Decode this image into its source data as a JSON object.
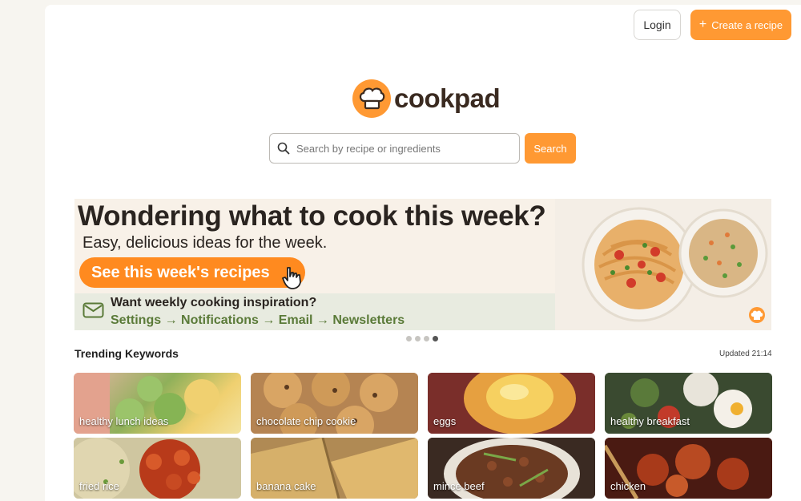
{
  "header": {
    "login_label": "Login",
    "create_label": "Create a recipe"
  },
  "logo": {
    "text": "cookpad"
  },
  "search": {
    "placeholder": "Search by recipe or ingredients",
    "button_label": "Search"
  },
  "banner": {
    "headline": "Wondering what to cook this week?",
    "subheadline": "Easy, delicious ideas for the week.",
    "cta_label": "See this week's recipes",
    "strip_title": "Want weekly cooking inspiration?",
    "strip_path": "Settings → Notifications → Email → Newsletters",
    "logo_text": "cookpad",
    "slide_count": 4,
    "active_slide": 4
  },
  "trending": {
    "title": "Trending Keywords",
    "updated": "Updated 21:14",
    "keywords": [
      {
        "label": "healthy lunch ideas"
      },
      {
        "label": "chocolate chip cookie"
      },
      {
        "label": "eggs"
      },
      {
        "label": "healthy breakfast"
      },
      {
        "label": "fried rice"
      },
      {
        "label": "banana cake"
      },
      {
        "label": "mince beef"
      },
      {
        "label": "chicken"
      }
    ]
  },
  "colors": {
    "accent": "#ff9933",
    "banner_cta": "#ff8a1f",
    "strip_text": "#5a7a38"
  }
}
